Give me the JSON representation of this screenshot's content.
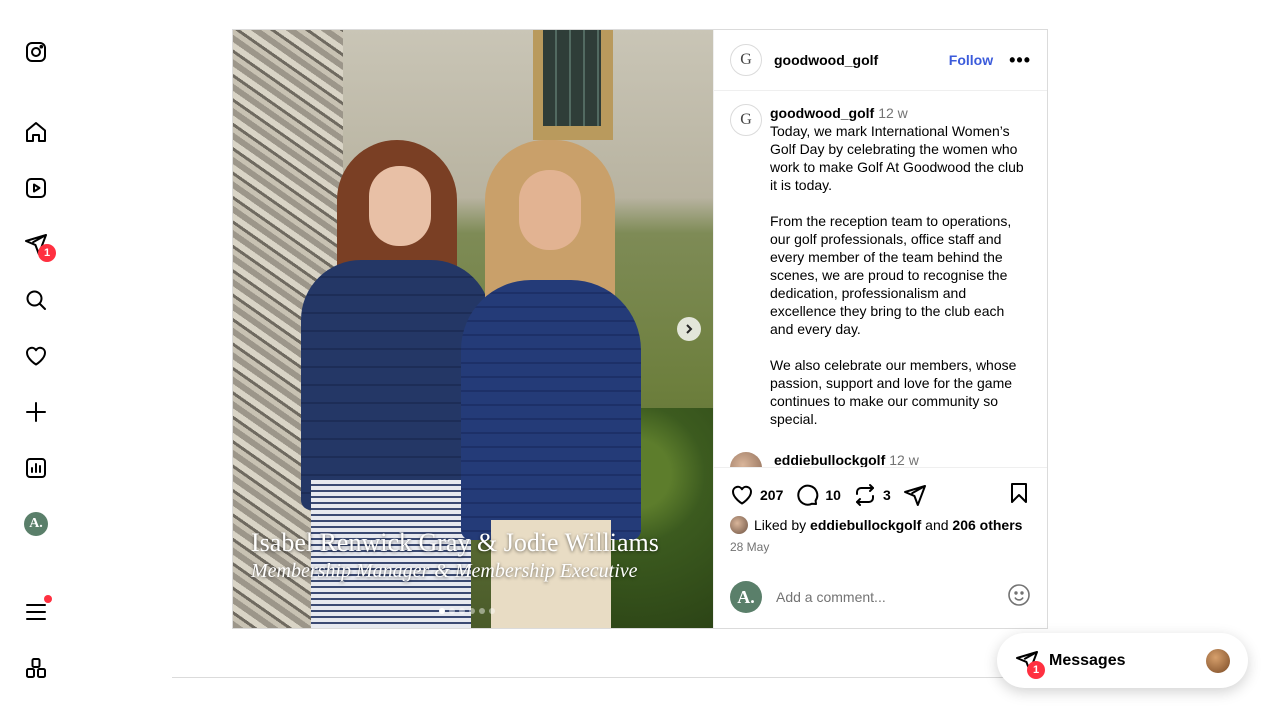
{
  "nav": {
    "items": [
      {
        "name": "instagram-logo-icon"
      },
      {
        "name": "home-icon"
      },
      {
        "name": "reels-icon"
      },
      {
        "name": "messages-icon",
        "badge": "1"
      },
      {
        "name": "search-icon"
      },
      {
        "name": "notifications-heart-icon"
      },
      {
        "name": "create-plus-icon"
      },
      {
        "name": "dashboard-icon"
      },
      {
        "name": "profile-avatar",
        "initial": "A."
      },
      {
        "name": "more-menu-icon"
      },
      {
        "name": "also-from-meta-icon"
      }
    ]
  },
  "post": {
    "author": "goodwood_golf",
    "author_logo": "G",
    "follow_label": "Follow",
    "more_label": "•••",
    "image_caption": {
      "names": "Isabel Renwick Gray & Jodie Williams",
      "roles": "Membership Manager & Membership Executive"
    },
    "carousel": {
      "count": 6,
      "active_index": 0
    },
    "caption": {
      "user": "goodwood_golf",
      "time": "12 w",
      "paragraphs": [
        "Today, we mark International Women’s Golf Day by celebrating the women who work to make Golf At Goodwood the club it is today.",
        "From the reception team to operations, our golf professionals, office staff and every member of the team behind the scenes, we are proud to recognise the dedication, professionalism and excellence they bring to the club each and every day.",
        "We also celebrate our members, whose passion, support and love for the game continues to make our community so special."
      ]
    },
    "comment": {
      "user": "eddiebullockgolf",
      "time": "12 w"
    },
    "counts": {
      "likes": "207",
      "comments": "10",
      "reposts": "3"
    },
    "liked_by": {
      "prefix": "Liked by",
      "user": "eddiebullockgolf",
      "and": "and",
      "others": "206 others"
    },
    "date": "28 May",
    "add_comment": {
      "avatar_initial": "A.",
      "placeholder": "Add a comment..."
    }
  },
  "messages_bar": {
    "label": "Messages",
    "badge": "1"
  },
  "colors": {
    "accent": "#3b5bdb",
    "badge": "#ff3040",
    "avatar_green": "#5a7f6a"
  }
}
